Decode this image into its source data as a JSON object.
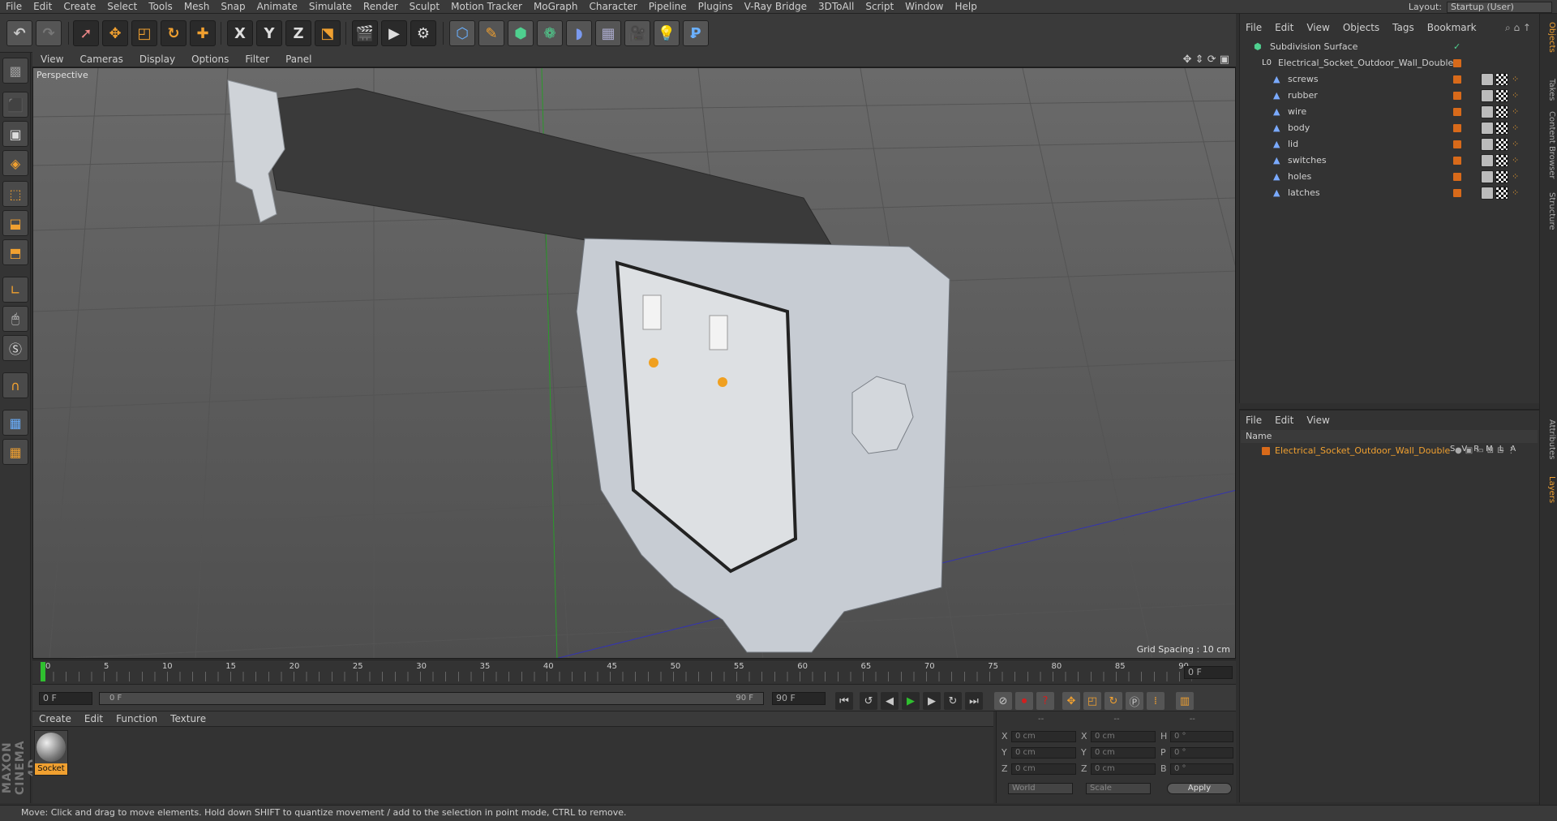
{
  "menubar": {
    "items": [
      "File",
      "Edit",
      "Create",
      "Select",
      "Tools",
      "Mesh",
      "Snap",
      "Animate",
      "Simulate",
      "Render",
      "Sculpt",
      "Motion Tracker",
      "MoGraph",
      "Character",
      "Pipeline",
      "Plugins",
      "V-Ray Bridge",
      "3DToAll",
      "Script",
      "Window",
      "Help"
    ],
    "layout_label": "Layout:",
    "layout_value": "Startup (User)"
  },
  "toolbar": {
    "icons": [
      "undo-icon",
      "redo-icon",
      "live-selection-icon",
      "move-icon",
      "scale-icon",
      "rotate-icon",
      "recent-tool-icon",
      "lock-x-icon",
      "lock-y-icon",
      "lock-z-icon",
      "world-coordinates-icon",
      "render-view-icon",
      "render-to-picture-viewer-icon",
      "edit-render-settings-icon",
      "cube-primitive-icon",
      "pen-spline-icon",
      "subdivision-surface-icon",
      "array-cloner-icon",
      "deformer-icon",
      "floor-icon",
      "camera-icon",
      "light-icon",
      "python-icon"
    ],
    "axis_x": "X",
    "axis_y": "Y",
    "axis_z": "Z"
  },
  "viewport": {
    "menu": [
      "View",
      "Cameras",
      "Display",
      "Options",
      "Filter",
      "Panel"
    ],
    "camera_label": "Perspective",
    "grid_spacing": "Grid Spacing : 10 cm"
  },
  "timeline": {
    "ticks": [
      "0",
      "5",
      "10",
      "15",
      "20",
      "25",
      "30",
      "35",
      "40",
      "45",
      "50",
      "55",
      "60",
      "65",
      "70",
      "75",
      "80",
      "85",
      "90"
    ],
    "current_frame": "0 F",
    "start_frame": "0 F",
    "range_start": "0 F",
    "range_end": "90 F",
    "end_frame": "90 F"
  },
  "material_manager": {
    "menu": [
      "Create",
      "Edit",
      "Function",
      "Texture"
    ],
    "material_name": "Socket"
  },
  "coordinates": {
    "header": [
      "--",
      "--",
      "--"
    ],
    "rows": [
      {
        "a": "X",
        "av": "0 cm",
        "b": "X",
        "bv": "0 cm",
        "c": "H",
        "cv": "0 °"
      },
      {
        "a": "Y",
        "av": "0 cm",
        "b": "Y",
        "bv": "0 cm",
        "c": "P",
        "cv": "0 °"
      },
      {
        "a": "Z",
        "av": "0 cm",
        "b": "Z",
        "bv": "0 cm",
        "c": "B",
        "cv": "0 °"
      }
    ],
    "mode1": "World",
    "mode2": "Scale",
    "apply": "Apply"
  },
  "object_manager": {
    "menu": [
      "File",
      "Edit",
      "View",
      "Objects",
      "Tags",
      "Bookmark"
    ],
    "objects": [
      {
        "name": "Subdivision Surface",
        "level": 0
      },
      {
        "name": "Electrical_Socket_Outdoor_Wall_Double",
        "level": 1
      },
      {
        "name": "screws",
        "level": 2
      },
      {
        "name": "rubber",
        "level": 2
      },
      {
        "name": "wire",
        "level": 2
      },
      {
        "name": "body",
        "level": 2
      },
      {
        "name": "lid",
        "level": 2
      },
      {
        "name": "switches",
        "level": 2
      },
      {
        "name": "holes",
        "level": 2
      },
      {
        "name": "latches",
        "level": 2
      }
    ]
  },
  "layer_manager": {
    "menu": [
      "File",
      "Edit",
      "View"
    ],
    "header_name": "Name",
    "header_cols": [
      "S",
      "V",
      "R",
      "M",
      "L",
      "A"
    ],
    "layer_name": "Electrical_Socket_Outdoor_Wall_Double",
    "layer_color": "#d86a1a"
  },
  "side_tabs": [
    "Objects",
    "Takes",
    "Content Browser",
    "Structure",
    "Attributes",
    "Layers"
  ],
  "status": "Move: Click and drag to move elements. Hold down SHIFT to quantize movement / add to the selection in point mode, CTRL to remove.",
  "brand": "MAXON CINEMA 4D",
  "colors": {
    "accent": "#d86a1a",
    "selected_text": "#f0a030",
    "play_green": "#2fbf2f",
    "record_red": "#d02020"
  }
}
